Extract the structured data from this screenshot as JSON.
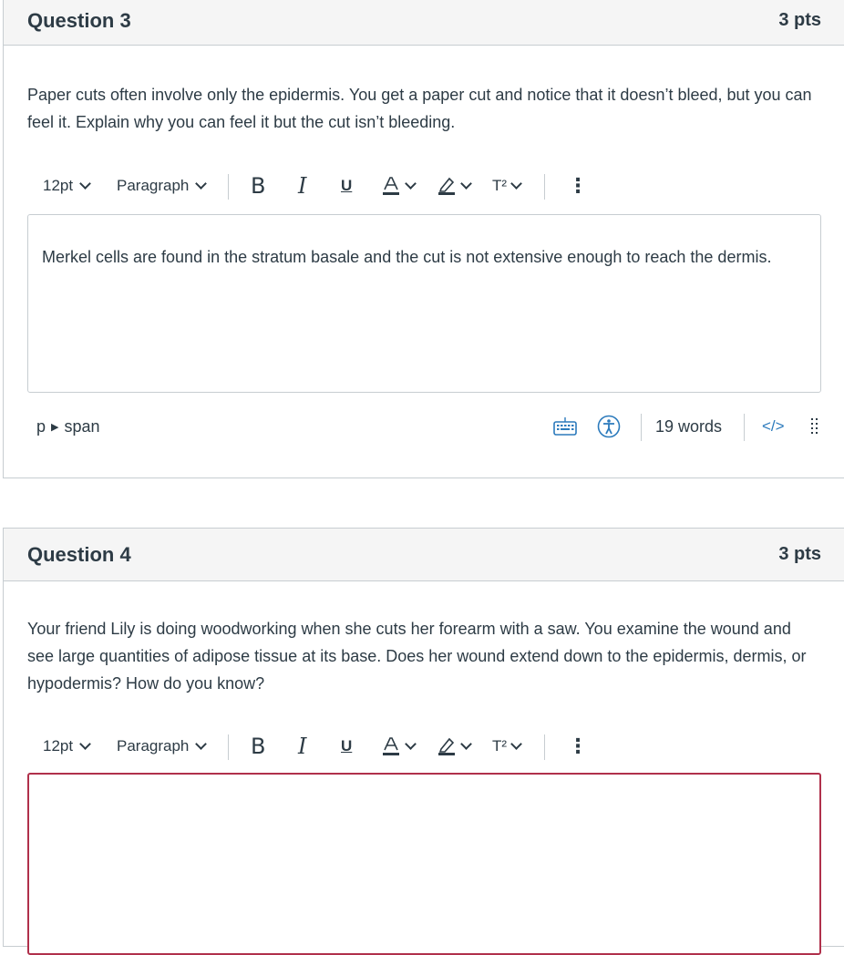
{
  "question3": {
    "title": "Question 3",
    "points": "3 pts",
    "text": "Paper cuts often involve only the epidermis. You get a paper cut and notice that it doesn’t bleed, but you can feel it. Explain why you can feel it but the cut isn’t bleeding.",
    "answer": "Merkel cells are found in the stratum basale and the cut is not extensive enough to reach the dermis.",
    "path_p": "p",
    "path_span": "span",
    "word_count": "19 words",
    "html_toggle": "</>"
  },
  "question4": {
    "title": "Question 4",
    "points": "3 pts",
    "text": "Your friend Lily is doing woodworking when she cuts her forearm with a saw. You examine the wound and see large quantities of adipose tissue at its base. Does her wound extend down to the epidermis, dermis, or hypodermis? How do you know?",
    "answer": ""
  },
  "toolbar": {
    "font_size": "12pt",
    "block_format": "Paragraph",
    "bold": "B",
    "italic": "I",
    "underline": "U",
    "superscript": "T²",
    "more": "⋮"
  },
  "colors": {
    "text": "#2d3b45",
    "header_bg": "#f5f5f5",
    "border": "#c7cdd1",
    "link_blue": "#2b7abc",
    "focus_border": "#b0304b"
  },
  "icons": [
    "chevron-down-icon",
    "text-color-icon",
    "highlight-icon",
    "keyboard-icon",
    "accessibility-icon",
    "drag-handle-icon",
    "arrow-right-icon"
  ]
}
